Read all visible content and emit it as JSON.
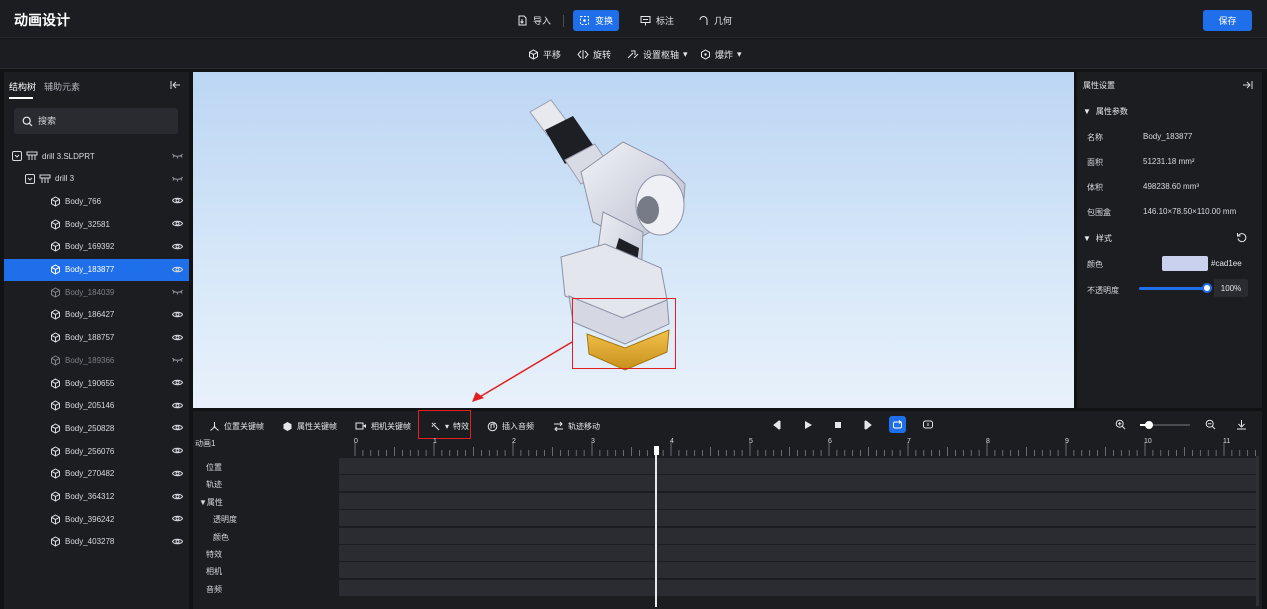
{
  "header": {
    "app_title": "动画设计",
    "import_label": "导入",
    "transform_label": "变换",
    "annotate_label": "标注",
    "geometry_label": "几何",
    "save_label": "保存"
  },
  "subtoolbar": {
    "translate_label": "平移",
    "rotate_label": "旋转",
    "set_axis_label": "设置枢轴",
    "explode_label": "爆炸"
  },
  "left_panel": {
    "tabs": [
      {
        "label": "结构树"
      },
      {
        "label": "辅助元素"
      }
    ],
    "search_placeholder": "搜索",
    "tree": [
      {
        "label": "drill 3.SLDPRT"
      },
      {
        "label": "drill 3"
      },
      {
        "label": "Body_766"
      },
      {
        "label": "Body_32581"
      },
      {
        "label": "Body_169392"
      },
      {
        "label": "Body_183877"
      },
      {
        "label": "Body_184039"
      },
      {
        "label": "Body_186427"
      },
      {
        "label": "Body_188757"
      },
      {
        "label": "Body_189366"
      },
      {
        "label": "Body_190655"
      },
      {
        "label": "Body_205146"
      },
      {
        "label": "Body_250828"
      },
      {
        "label": "Body_256076"
      },
      {
        "label": "Body_270482"
      },
      {
        "label": "Body_364312"
      },
      {
        "label": "Body_396242"
      },
      {
        "label": "Body_403278"
      }
    ]
  },
  "right_panel": {
    "title": "属性设置",
    "params_section": "属性参数",
    "name_label": "名称",
    "name_value": "Body_183877",
    "area_label": "面积",
    "area_value": "51231.18 mm²",
    "volume_label": "体积",
    "volume_value": "498238.60 mm³",
    "bbox_label": "包围盒",
    "bbox_value": "146.10×78.50×110.00 mm",
    "style_section": "样式",
    "color_label": "颜色",
    "color_value": "#cad1ee",
    "opacity_label": "不透明度",
    "opacity_value": "100%",
    "opacity_fraction": 1.0
  },
  "timeline": {
    "position_keyframe_label": "位置关键帧",
    "property_keyframe_label": "属性关键帧",
    "camera_keyframe_label": "相机关键帧",
    "effects_label": "特效",
    "insert_audio_label": "插入音频",
    "trajectory_move_label": "轨迹移动",
    "animation_name": "动画1",
    "ticks": [
      "0",
      "1",
      "2",
      "3",
      "4",
      "5",
      "6",
      "7",
      "8",
      "9",
      "10",
      "11"
    ],
    "tracks": [
      {
        "label": "位置"
      },
      {
        "label": "轨迹"
      },
      {
        "label": "▼属性"
      },
      {
        "label": "透明度"
      },
      {
        "label": "颜色"
      },
      {
        "label": "特效"
      },
      {
        "label": "相机"
      },
      {
        "label": "音频"
      }
    ],
    "playhead_time": 3.8
  },
  "colors": {
    "accent": "#1f6feb",
    "highlight": "#e02020",
    "swatch": "#cad1ee"
  }
}
